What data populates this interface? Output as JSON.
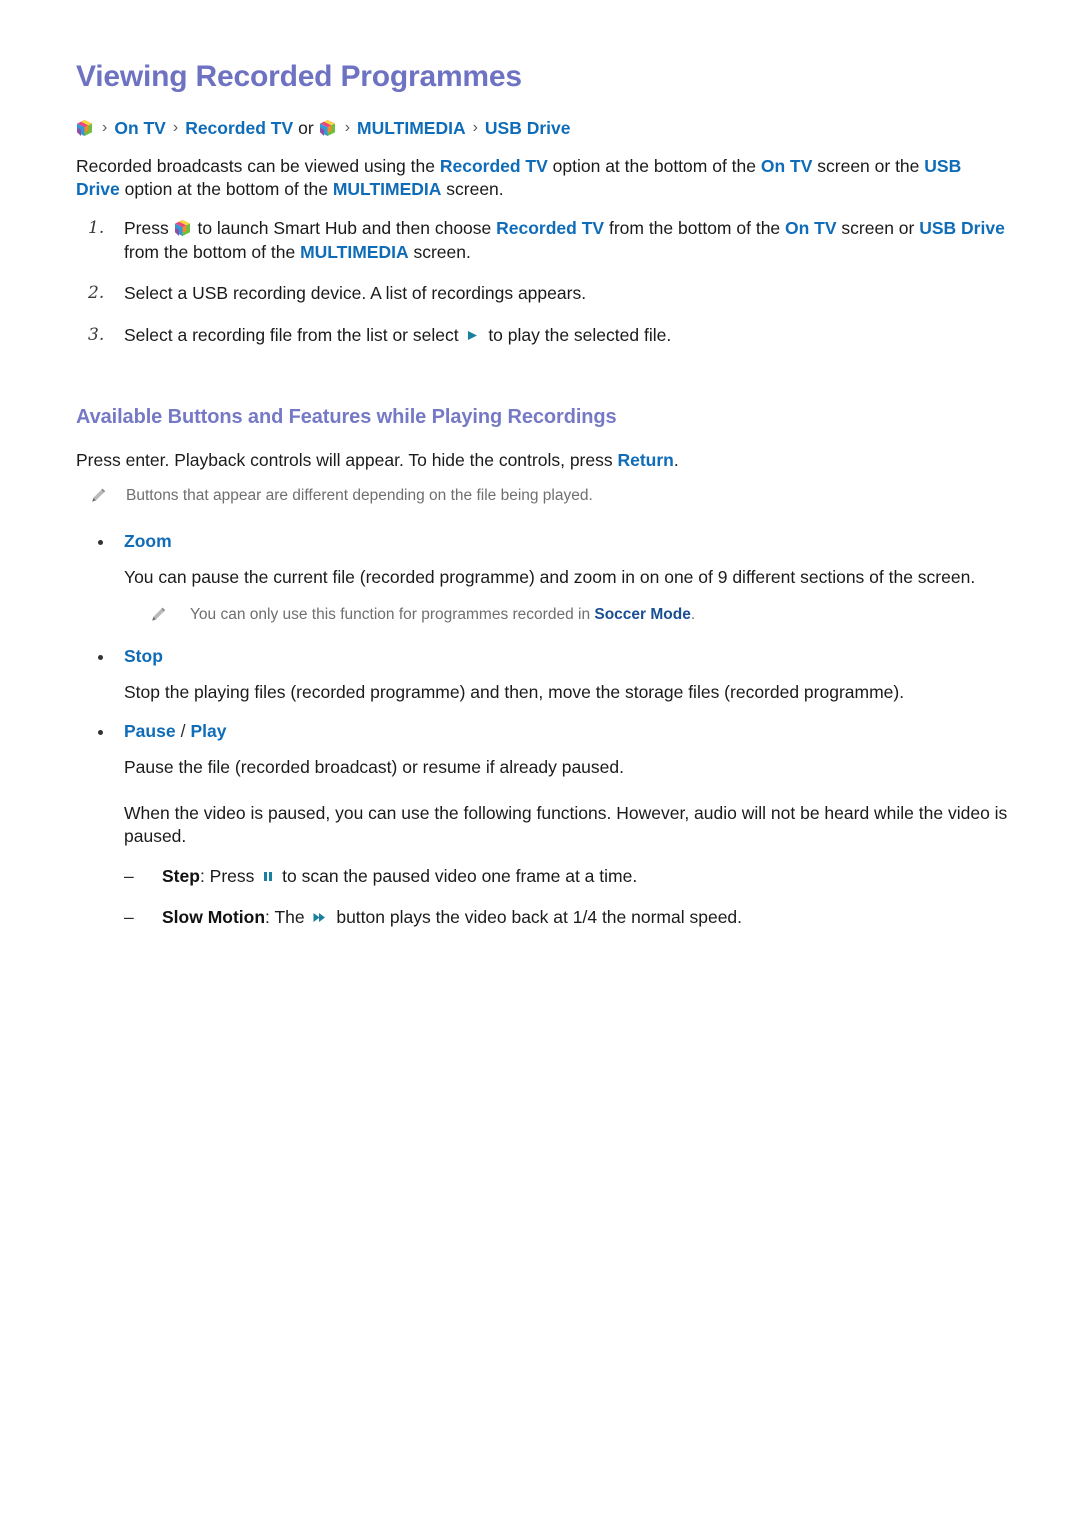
{
  "colors": {
    "title_purple": "#6d72c3",
    "section_purple": "#7579c6",
    "link_blue": "#0f6cb8",
    "link_dark_blue": "#1a4f94",
    "body_black": "#1b1b1b",
    "note_gray": "#6f6f6f",
    "media_icon_teal": "#1b7f9e"
  },
  "page": {
    "title": "Viewing Recorded Programmes"
  },
  "breadcrumb": {
    "icon_1": "smart-hub-cube-icon",
    "crumb_1": "On TV",
    "sep": "›",
    "crumb_2": "Recorded TV",
    "conjunction": "or",
    "icon_2": "smart-hub-cube-icon",
    "crumb_3": "MULTIMEDIA",
    "crumb_4": "USB Drive"
  },
  "intro": {
    "part_1": "Recorded broadcasts can be viewed using the ",
    "link_1": "Recorded TV",
    "part_2": " option at the bottom of the ",
    "link_2": "On TV",
    "part_3": " screen or the ",
    "link_3": "USB Drive",
    "part_4": " option at the bottom of the ",
    "link_4": "MULTIMEDIA",
    "part_5": " screen."
  },
  "steps": [
    {
      "num": "1.",
      "part_1": "Press ",
      "icon": "smart-hub-cube-icon",
      "part_2": " to launch Smart Hub and then choose ",
      "link_1": "Recorded TV",
      "part_3": " from the bottom of the ",
      "link_2": "On TV",
      "part_4": " screen or ",
      "link_3": "USB Drive",
      "part_5": " from the bottom of the ",
      "link_4": "MULTIMEDIA",
      "part_6": " screen."
    },
    {
      "num": "2.",
      "text": "Select a USB recording device. A list of recordings appears."
    },
    {
      "num": "3.",
      "part_1": "Select a recording file from the list or select ",
      "icon": "play-icon",
      "part_2": " to play the selected file."
    }
  ],
  "section": {
    "title": "Available Buttons and Features while Playing Recordings",
    "intro": {
      "part_1": "Press enter. Playback controls will appear. To hide the controls, press ",
      "link_1": "Return",
      "part_2": "."
    },
    "note_1": {
      "icon": "pencil-note-icon",
      "text": "Buttons that appear are different depending on the file being played."
    }
  },
  "features": [
    {
      "bullet": "•",
      "label": "Zoom",
      "body": "You can pause the current file (recorded programme) and zoom in on one of 9 different sections of the screen.",
      "note": {
        "icon": "pencil-note-icon",
        "part_1": "You can only use this function for programmes recorded in ",
        "link_1": "Soccer Mode",
        "part_2": "."
      }
    },
    {
      "bullet": "•",
      "label": "Stop",
      "body": "Stop the playing files (recorded programme) and then, move the storage files (recorded programme)."
    },
    {
      "bullet": "•",
      "label": "Pause",
      "separator": "/",
      "label_2": "Play",
      "body": "Pause the file (recorded broadcast) or resume if already paused.",
      "body_2": "When the video is paused, you can use the following functions. However, audio will not be heard while the video is paused."
    }
  ],
  "sub_items": [
    {
      "dash": "–",
      "label": "Step",
      "part_1": ": Press ",
      "icon": "pause-icon",
      "part_2": " to scan the paused video one frame at a time."
    },
    {
      "dash": "–",
      "label": "Slow Motion",
      "part_1": ": The ",
      "icon": "fast-forward-icon",
      "part_2": " button plays the video back at 1/4 the normal speed."
    }
  ]
}
